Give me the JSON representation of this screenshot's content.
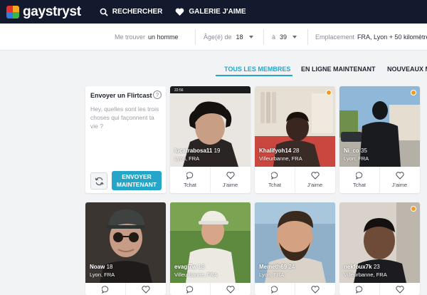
{
  "nav": {
    "logo_text": "gaystryst",
    "links": [
      {
        "label": "RECHERCHER",
        "icon": "search-icon"
      },
      {
        "label": "GALERIE J'AIME",
        "icon": "heart-icon"
      }
    ]
  },
  "filters": {
    "find_label": "Me trouver",
    "find_value": "un homme",
    "age_label": "Âge(é) de",
    "age_min": "18",
    "age_to_label": "à",
    "age_max": "39",
    "location_label": "Emplacement",
    "location_value": "FRA, Lyon + 50 kilomètres"
  },
  "tabs": [
    {
      "label": "TOUS LES MEMBRES",
      "active": true
    },
    {
      "label": "EN LIGNE MAINTENANT",
      "active": false
    },
    {
      "label": "NOUVEAUX M",
      "active": false
    }
  ],
  "flirtcast": {
    "title": "Envoyer un Flirtcast",
    "help": "?",
    "message": "Hey, quelles sont les trois choses qui façonnent ta vie ?",
    "send_label": "ENVOYER MAINTENANT"
  },
  "actions": {
    "chat": "Tchat",
    "like": "J'aime"
  },
  "profiles": [
    {
      "name": "lucatrabosa11",
      "age": "19",
      "location": "Lyon, FRA",
      "online": false
    },
    {
      "name": "Khalifyoh14",
      "age": "28",
      "location": "Villeurbanne, FRA",
      "online": true
    },
    {
      "name": "Ni_co",
      "age": "35",
      "location": "Lyon, FRA",
      "online": true
    },
    {
      "name": "Noaw",
      "age": "18",
      "location": "Lyon, FRA",
      "online": false
    },
    {
      "name": "evagi7w",
      "age": "18",
      "location": "Villeurbanne, FRA",
      "online": false
    },
    {
      "name": "Memeth69",
      "age": "24",
      "location": "Lyon, FRA",
      "online": false
    },
    {
      "name": "nekfoux7k",
      "age": "23",
      "location": "Villeurbanne, FRA",
      "online": true
    }
  ],
  "colors": {
    "accent": "#25a6c9",
    "nav_bg": "#141a2e",
    "online": "#f39a1e"
  }
}
